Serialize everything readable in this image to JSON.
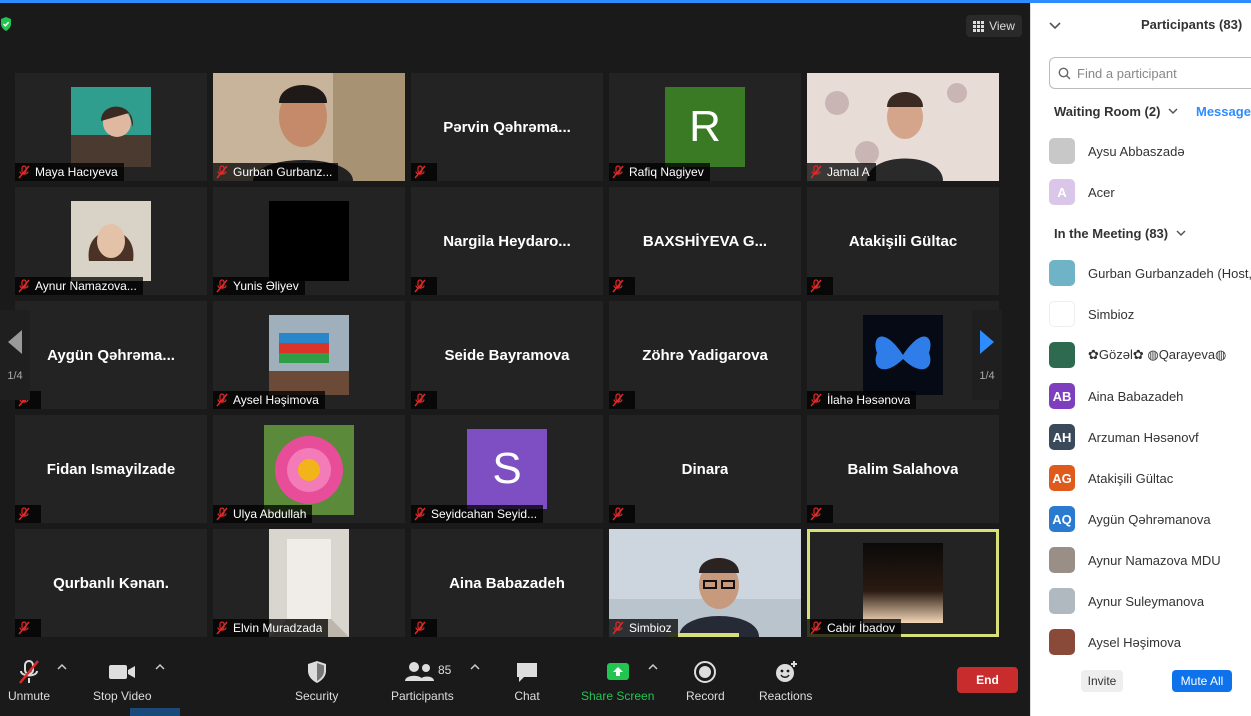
{
  "stage": {
    "view_label": "View",
    "page_indicator_left": "1/4",
    "page_indicator_right": "1/4"
  },
  "tiles": [
    {
      "name": "Maya Hacıyeva",
      "display": "",
      "avatar": "photo-teal"
    },
    {
      "name": "Gurban Gurbanz...",
      "display": "",
      "avatar": "photo-man"
    },
    {
      "name": "",
      "display": "Pərvin  Qəhrəma...",
      "avatar": ""
    },
    {
      "name": "Rafiq Nagiyev",
      "display": "",
      "avatar": "letter",
      "letter": "R",
      "color": "#3a7a24"
    },
    {
      "name": "Jamal A",
      "display": "",
      "avatar": "photo-room"
    },
    {
      "name": "Aynur Namazova...",
      "display": "",
      "avatar": "photo-woman"
    },
    {
      "name": "Yunis Əliyev",
      "display": "",
      "avatar": "black"
    },
    {
      "name": "",
      "display": "Nargila  Heydaro...",
      "avatar": ""
    },
    {
      "name": "",
      "display": "BAXSHİYEVA  G...",
      "avatar": ""
    },
    {
      "name": "",
      "display": "Atakişili Gültac",
      "avatar": ""
    },
    {
      "name": "",
      "display": "Aygün  Qəhrəma...",
      "avatar": ""
    },
    {
      "name": "Aysel Həşimova",
      "display": "",
      "avatar": "photo-flag"
    },
    {
      "name": "",
      "display": "Seide Bayramova",
      "avatar": ""
    },
    {
      "name": "",
      "display": "Zöhrə Yadigarova",
      "avatar": ""
    },
    {
      "name": "İlahə Həsənova",
      "display": "",
      "avatar": "photo-butterfly"
    },
    {
      "name": "",
      "display": "Fidan Ismayilzade",
      "avatar": ""
    },
    {
      "name": "Ulya Abdullah",
      "display": "",
      "avatar": "photo-flower"
    },
    {
      "name": "Seyidcahan Seyid...",
      "display": "",
      "avatar": "letter",
      "letter": "S",
      "color": "#7e4fc2"
    },
    {
      "name": "",
      "display": "Dinara",
      "avatar": ""
    },
    {
      "name": "",
      "display": "Balim Salahova",
      "avatar": ""
    },
    {
      "name": "",
      "display": "Qurbanlı Kənan.",
      "avatar": ""
    },
    {
      "name": "Elvin Muradzada",
      "display": "",
      "avatar": "photo-hall"
    },
    {
      "name": "",
      "display": "Aina Babazadeh",
      "avatar": ""
    },
    {
      "name": "Simbioz",
      "display": "",
      "avatar": "video-simbioz"
    },
    {
      "name": "Cabir İbadov",
      "display": "",
      "avatar": "photo-dark"
    }
  ],
  "toolbar": {
    "unmute": "Unmute",
    "stop_video": "Stop Video",
    "security": "Security",
    "participants": "Participants",
    "participants_count": "85",
    "chat": "Chat",
    "share_screen": "Share Screen",
    "record": "Record",
    "reactions": "Reactions",
    "end": "End"
  },
  "panel": {
    "title": "Participants (83)",
    "search_placeholder": "Find a participant",
    "waiting_room": "Waiting Room (2)",
    "message": "Message",
    "in_meeting": "In the Meeting (83)",
    "invite": "Invite",
    "mute_all": "Mute All"
  },
  "waiting": [
    {
      "name": "Aysu Abbaszadə",
      "initials": "",
      "color": "#c8c8c8"
    },
    {
      "name": "Acer",
      "initials": "A",
      "color": "#d9c6e8"
    }
  ],
  "meeting": [
    {
      "name": "Gurban Gurbanzadeh (Host, me)",
      "initials": "",
      "color": "#6fb3c7"
    },
    {
      "name": "Simbioz",
      "initials": "",
      "color": "#ffffff"
    },
    {
      "name": "✿Gözəl✿ ◍Qarayeva◍",
      "initials": "",
      "color": "#2d6a4f"
    },
    {
      "name": "Aina Babazadeh",
      "initials": "AB",
      "color": "#7e3fbf"
    },
    {
      "name": "Arzuman Həsənovf",
      "initials": "AH",
      "color": "#3b4a5a"
    },
    {
      "name": "Atakişili Gültac",
      "initials": "AG",
      "color": "#e05a1c"
    },
    {
      "name": "Aygün Qəhrəmanova",
      "initials": "AQ",
      "color": "#2a7bd0"
    },
    {
      "name": "Aynur Namazova MDU",
      "initials": "",
      "color": "#9a8f87"
    },
    {
      "name": "Aynur Suleymanova",
      "initials": "",
      "color": "#b0b9c0"
    },
    {
      "name": "Aysel Həşimova",
      "initials": "",
      "color": "#8a4a3a"
    }
  ]
}
